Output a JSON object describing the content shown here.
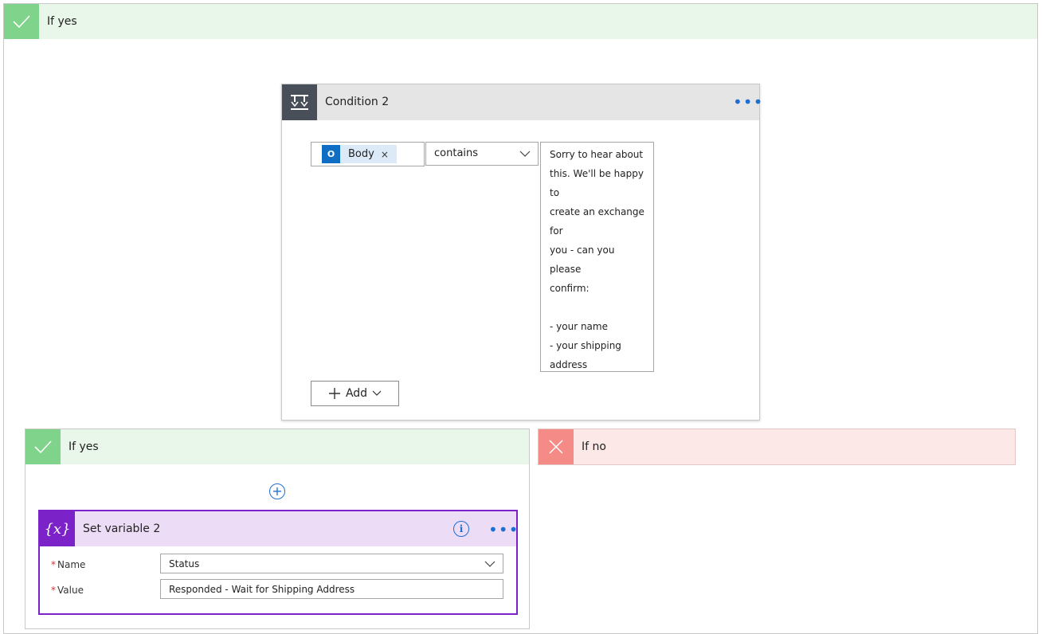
{
  "outer_branch": {
    "label": "If yes"
  },
  "condition": {
    "title": "Condition 2",
    "more_glyph": "•••",
    "left_operand": {
      "token_label": "Body",
      "token_icon": "outlook-icon",
      "remove_glyph": "×"
    },
    "operator": {
      "selected": "contains"
    },
    "right_operand": "Sorry to hear about\nthis. We'll be happy to\ncreate an exchange for\nyou - can you please\nconfirm:\n\n- your name\n- your shipping\naddress\n\nLooking forward to\nhearing from you.",
    "add_button": "Add"
  },
  "yes_branch": {
    "label": "If yes",
    "insert_glyph": "+"
  },
  "no_branch": {
    "label": "If no"
  },
  "set_variable": {
    "title": "Set variable 2",
    "icon_glyph": "{x}",
    "more_glyph": "•••",
    "info_glyph": "i",
    "name_label": "Name",
    "name_value": "Status",
    "value_label": "Value",
    "value_value": "Responded - Wait for Shipping Address",
    "required_mark": "*"
  },
  "colors": {
    "yes_accent": "#7fd38a",
    "yes_header_bg": "#e9f6ea",
    "no_accent": "#f58b86",
    "no_header_bg": "#fde8e8",
    "condition_icon_bg": "#484f58",
    "variable_accent": "#7b22c9",
    "variable_header_bg": "#ecdcf6",
    "link_blue": "#1f6fd1"
  }
}
